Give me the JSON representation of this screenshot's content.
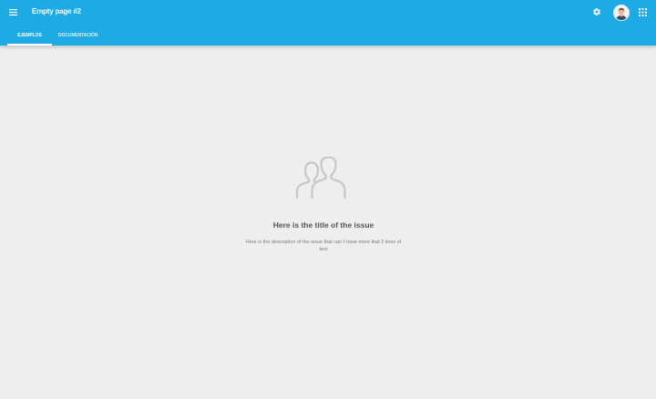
{
  "appbar": {
    "title": "Empty page #2",
    "color": "#1eaae4",
    "icons": [
      "menu-icon",
      "settings-icon",
      "avatar",
      "apps-grid-icon"
    ]
  },
  "tabs": [
    {
      "label": "Ejemplos",
      "active": true
    },
    {
      "label": "Documentación",
      "active": false
    }
  ],
  "empty_state": {
    "icon": "people-icon",
    "title": "Here is the title of the issue",
    "description": "Here is the description of the issue that can´t have more that 2 lines of text"
  }
}
